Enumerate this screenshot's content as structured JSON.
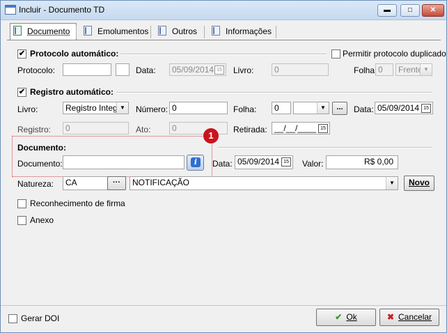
{
  "window": {
    "title": "Incluir - Documento TD",
    "minimize": "▬",
    "maximize": "□",
    "close": "✕"
  },
  "tabs": [
    {
      "label": "Documento",
      "active": true
    },
    {
      "label": "Emolumentos"
    },
    {
      "label": "Outros"
    },
    {
      "label": "Informações"
    }
  ],
  "protocolo": {
    "section_label": "Protocolo automático:",
    "checked_mark": "✔",
    "permitir_label": "Permitir protocolo duplicado",
    "protocolo_label": "Protocolo:",
    "protocolo_value": "",
    "data_label": "Data:",
    "data_value": "05/09/2014",
    "livro_label": "Livro:",
    "livro_value": "0",
    "folha_label": "Folha:",
    "folha_value": "0",
    "frente_value": "Frente"
  },
  "registro": {
    "section_label": "Registro automático:",
    "checked_mark": "✔",
    "livro_label": "Livro:",
    "livro_value": "Registro Integr",
    "numero_label": "Número:",
    "numero_value": "0",
    "folha_label": "Folha:",
    "folha_value": "0",
    "folha_ellipsis": "...",
    "data_label": "Data:",
    "data_value": "05/09/2014",
    "registro_label": "Registro:",
    "registro_value": "0",
    "ato_label": "Ato:",
    "ato_value": "0",
    "retirada_label": "Retirada:",
    "retirada_value": "__/__/____"
  },
  "documento": {
    "section_label": "Documento:",
    "doc_label": "Documento:",
    "doc_value": "",
    "info_glyph": "i",
    "badge": "1",
    "data_label": "Data:",
    "data_value": "05/09/2014",
    "valor_label": "Valor:",
    "valor_value": "R$ 0,00"
  },
  "natureza": {
    "label": "Natureza:",
    "code": "CA",
    "ellipsis": "···",
    "description": "NOTIFICAÇÃO",
    "novo_button": "Novo"
  },
  "options": {
    "reconhecimento_label": "Reconhecimento de firma",
    "anexo_label": "Anexo"
  },
  "footer": {
    "gerar_doi_label": "Gerar DOI",
    "ok_label": "Ok",
    "cancelar_label": "Cancelar"
  },
  "calendar_glyph": "15",
  "dropdown_glyph": "▼",
  "colors": {
    "badge": "#c9141d",
    "info": "#2f6fcf",
    "ok_check": "#3a9a2a",
    "cancel_x": "#c8202a"
  }
}
